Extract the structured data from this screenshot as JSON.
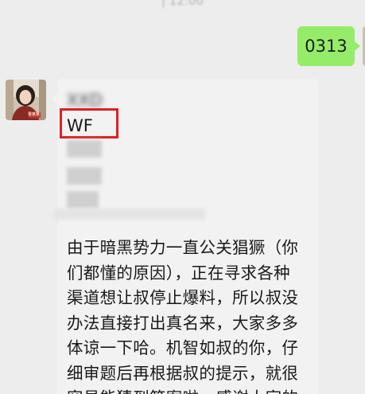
{
  "chat": {
    "timestamp": "| 12:00",
    "outgoing": {
      "text": "0313"
    },
    "incoming": {
      "sender_blur": "XXD",
      "keyword": "WF",
      "body_lines": [
        "由于暗黑势力一直公关猖獗（你",
        "们都懂的原因），正在寻求各种",
        "渠道想让叔停止爆料，所以叔没",
        "办法直接打出真名来，大家多多",
        "体谅一下哈。机智如叔的你，仔",
        "细审题后再根据叔的提示，就很",
        "容易能猜到答案啦，感谢大家的"
      ]
    },
    "avatar_badge": "曹某某"
  },
  "colors": {
    "background": "#ededed",
    "outgoing_bubble": "#95ec69",
    "incoming_bubble": "#f2f2f2",
    "highlight": "#e02020"
  },
  "icons": {
    "avatar": "contact-avatar-photo"
  }
}
